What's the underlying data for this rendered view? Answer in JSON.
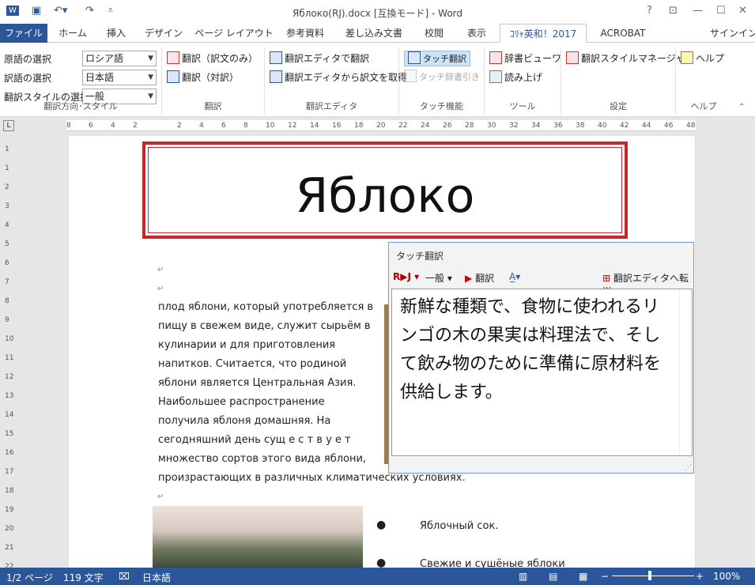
{
  "window": {
    "title": "Яблоко(RJ).docx [互換モード] - Word",
    "help": "?",
    "qat": {
      "save": "Save",
      "undo": "Undo",
      "redo": "Redo"
    }
  },
  "tabs": [
    {
      "label": "ファイル"
    },
    {
      "label": "ホーム"
    },
    {
      "label": "挿入"
    },
    {
      "label": "デザイン"
    },
    {
      "label": "ページ レイアウト"
    },
    {
      "label": "参考資料"
    },
    {
      "label": "差し込み文書"
    },
    {
      "label": "校閲"
    },
    {
      "label": "表示"
    },
    {
      "label": "ｺﾘｬ英和！2017"
    },
    {
      "label": "ACROBAT"
    }
  ],
  "signin": "サインイン",
  "ribbon": {
    "dir": {
      "src_label": "原語の選択",
      "src_value": "ロシア語",
      "tgt_label": "訳語の選択",
      "tgt_value": "日本語",
      "style_label": "翻訳スタイルの選択",
      "style_value": "一般",
      "group": "翻訳方向･スタイル"
    },
    "translate": {
      "b1": "翻訳（訳文のみ）",
      "b2": "翻訳（対訳）",
      "group": "翻訳"
    },
    "editor": {
      "b1": "翻訳エディタで翻訳",
      "b2": "翻訳エディタから訳文を取得",
      "group": "翻訳エディタ"
    },
    "touch": {
      "b1": "タッチ翻訳",
      "b2": "タッチ辞書引き",
      "group": "タッチ機能"
    },
    "tools": {
      "b1": "辞書ビューワ",
      "b2": "読み上げ",
      "group": "ツール"
    },
    "settings": {
      "b1": "翻訳スタイルマネージャ",
      "group": "設定"
    },
    "help": {
      "b1": "ヘルプ",
      "group": "ヘルプ"
    }
  },
  "ruler": {
    "h_ticks": [
      "8",
      "6",
      "4",
      "2",
      "2",
      "4",
      "6",
      "8",
      "10",
      "12",
      "14",
      "16",
      "18",
      "20",
      "22",
      "24",
      "26",
      "28",
      "30",
      "32",
      "34",
      "36",
      "38",
      "40",
      "42",
      "44",
      "46",
      "48"
    ],
    "v_ticks": [
      "1",
      "1",
      "2",
      "3",
      "4",
      "5",
      "6",
      "7",
      "8",
      "9",
      "10",
      "11",
      "12",
      "13",
      "14",
      "15",
      "16",
      "17",
      "18",
      "19",
      "20",
      "21",
      "22"
    ]
  },
  "document": {
    "title": "Яблоко",
    "lines": [
      "плод яблони, который употребляется в",
      "пищу в свежем виде, служит сырьём в",
      "кулинарии и для приготовления",
      "напитков. Считается, что родиной",
      "яблони является Центральная Азия.",
      "Наибольшее распространение",
      "получила яблоня домашняя. На",
      "сегодняшний день сущ е с т в у е т",
      "множество сортов этого вида яблони,",
      "произрастающих в различных климатических условиях."
    ],
    "bullets": [
      "Яблочный  сок.",
      "Свежие и сушёные яблоки"
    ]
  },
  "popup": {
    "title": "タッチ翻訳",
    "dir": "R▶J",
    "style": "一般",
    "translate": "翻訳",
    "send": "翻訳エディタへ転送",
    "text": "新鮮な種類で、食物に使われるリンゴの木の果実は料理法で、そして飲み物のために準備に原材料を供給します。"
  },
  "status": {
    "page": "1/2 ページ",
    "words": "119 文字",
    "lang": "日本語",
    "zoom": "100%"
  },
  "colors": {
    "accent": "#2b579a",
    "title_border": "#c8262f"
  }
}
